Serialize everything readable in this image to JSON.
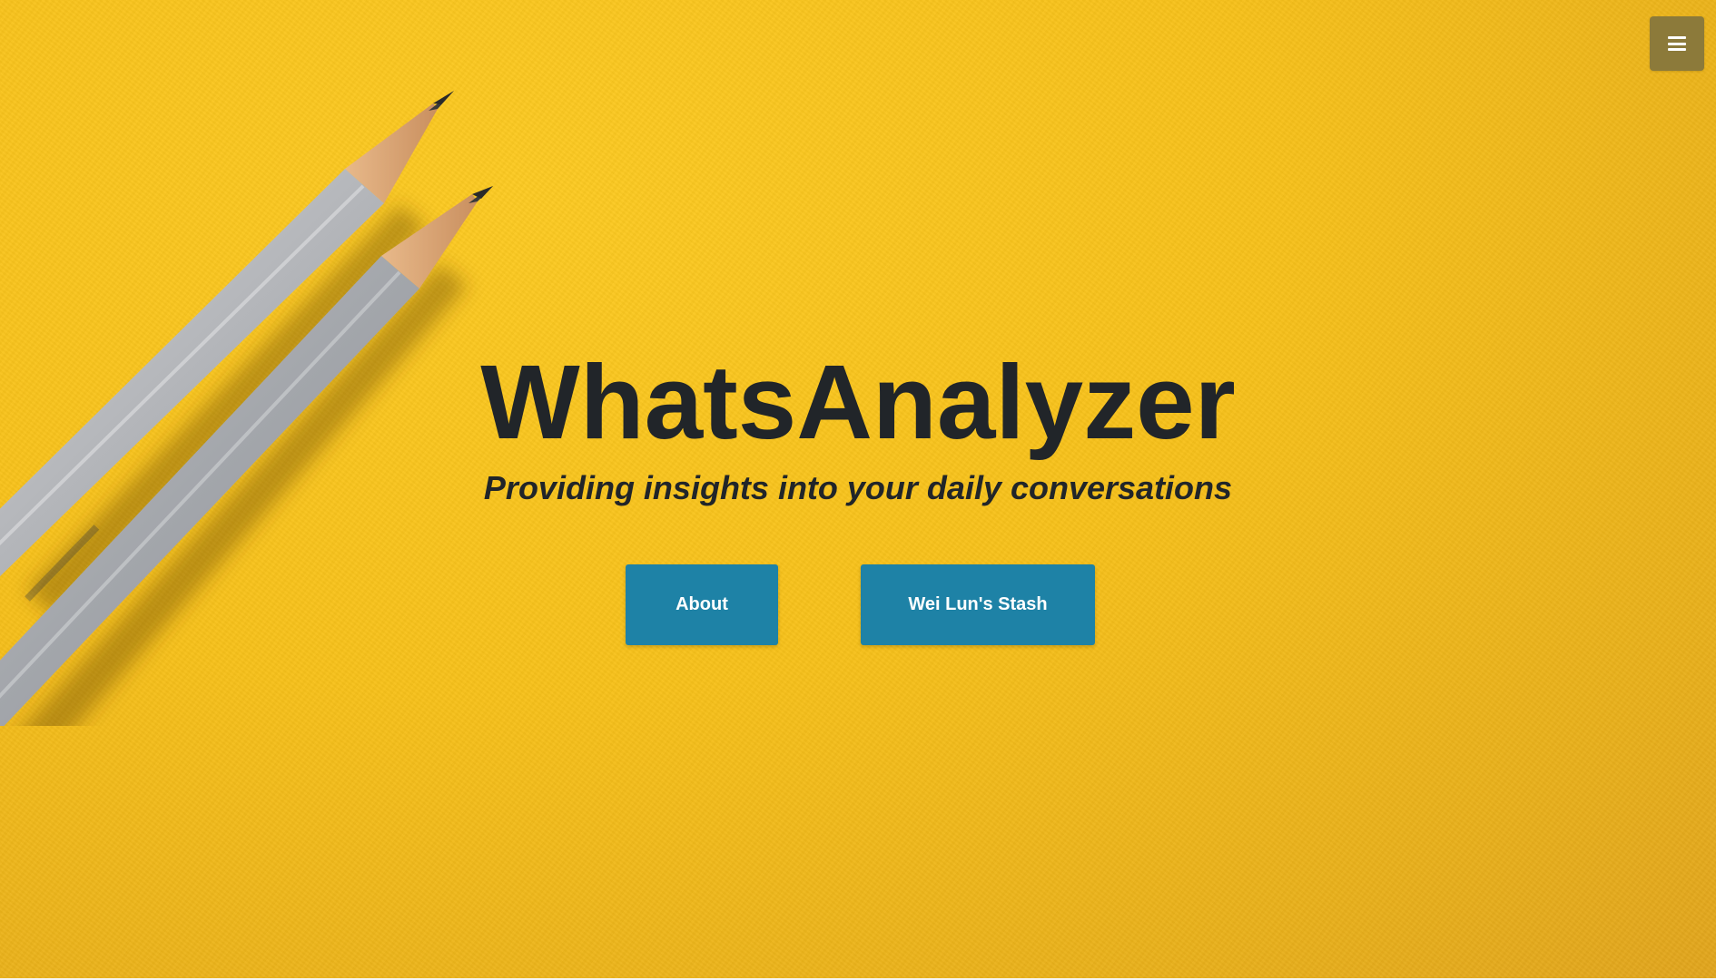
{
  "colors": {
    "background": "#f7c11a",
    "text": "#212529",
    "button": "#1e82a6",
    "button_text": "#ffffff",
    "menu_button": "#8c7a3a"
  },
  "header": {
    "menu_icon": "hamburger-menu-icon"
  },
  "hero": {
    "image": "two-grey-pencils-on-yellow-paper",
    "title": "WhatsAnalyzer",
    "subtitle": "Providing insights into your daily conversations",
    "buttons": {
      "about_label": "About",
      "stash_label": "Wei Lun's Stash"
    }
  }
}
